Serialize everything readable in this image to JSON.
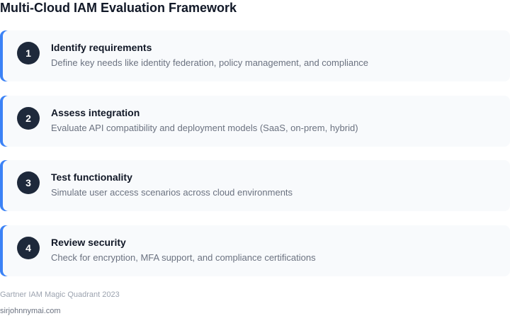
{
  "title": "Multi-Cloud IAM Evaluation Framework",
  "steps": [
    {
      "number": "1",
      "title": "Identify requirements",
      "description": "Define key needs like identity federation, policy management, and compliance"
    },
    {
      "number": "2",
      "title": "Assess integration",
      "description": "Evaluate API compatibility and deployment models (SaaS, on-prem, hybrid)"
    },
    {
      "number": "3",
      "title": "Test functionality",
      "description": "Simulate user access scenarios across cloud environments"
    },
    {
      "number": "4",
      "title": "Review security",
      "description": "Check for encryption, MFA support, and compliance certifications"
    }
  ],
  "source": "Gartner IAM Magic Quadrant 2023",
  "credit": "sirjohnnymai.com",
  "colors": {
    "accent": "#3b82f6",
    "badge": "#1e293b",
    "card_background": "#f8fafc"
  }
}
